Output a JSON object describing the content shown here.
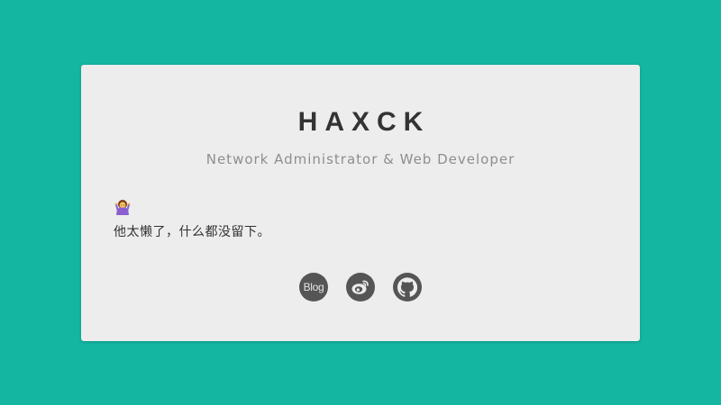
{
  "profile": {
    "name": "HAXCK",
    "tagline": "Network Administrator & Web Developer",
    "bio": "他太懒了，什么都没留下。"
  },
  "socials": {
    "blog_label": "Blog",
    "weibo_icon": "weibo-icon",
    "github_icon": "github-icon"
  },
  "colors": {
    "background": "#14b5a1",
    "card": "#ededed",
    "icon_circle": "#555555",
    "title": "#333333",
    "subtitle": "#8e8e8e"
  }
}
